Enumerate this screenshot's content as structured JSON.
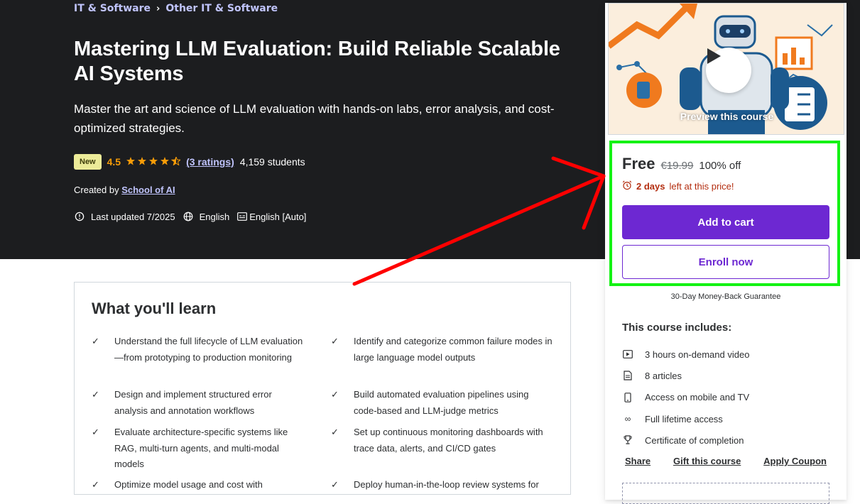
{
  "breadcrumb": {
    "items": [
      "IT & Software",
      "Other IT & Software"
    ]
  },
  "course": {
    "title": "Mastering LLM Evaluation: Build Reliable Scalable AI Systems",
    "subtitle": "Master the art and science of LLM evaluation with hands-on labs, error analysis, and cost-optimized strategies.",
    "badge": "New",
    "rating": "4.5",
    "rating_value": 4.5,
    "ratings_count": "(3 ratings)",
    "students": "4,159 students",
    "created_by_label": "Created by",
    "author": "School of AI",
    "last_updated": "Last updated 7/2025",
    "language": "English",
    "captions": "English [Auto]"
  },
  "learn": {
    "title": "What you'll learn",
    "items": [
      "Understand the full lifecycle of LLM evaluation—from prototyping to production monitoring",
      "Identify and categorize common failure modes in large language model outputs",
      "Design and implement structured error analysis and annotation workflows",
      "Build automated evaluation pipelines using code-based and LLM-judge metrics",
      "Evaluate architecture-specific systems like RAG, multi-turn agents, and multi-modal models",
      "Set up continuous monitoring dashboards with trace data, alerts, and CI/CD gates",
      "Optimize model usage and cost with",
      "Deploy human-in-the-loop review systems for"
    ]
  },
  "sidebar": {
    "preview_label": "Preview this course",
    "price": "Free",
    "original_price": "€19.99",
    "discount": "100% off",
    "timer_bold": "2 days",
    "timer_rest": "left at this price!",
    "add_to_cart": "Add to cart",
    "enroll_now": "Enroll now",
    "guarantee": "30-Day Money-Back Guarantee",
    "includes_title": "This course includes:",
    "includes": [
      {
        "icon": "video-icon",
        "label": "3 hours on-demand video"
      },
      {
        "icon": "article-icon",
        "label": "8 articles"
      },
      {
        "icon": "mobile-icon",
        "label": "Access on mobile and TV"
      },
      {
        "icon": "infinity-icon",
        "label": "Full lifetime access"
      },
      {
        "icon": "trophy-icon",
        "label": "Certificate of completion"
      }
    ],
    "links": [
      "Share",
      "Gift this course",
      "Apply Coupon"
    ]
  },
  "colors": {
    "hero_bg": "#1c1d1f",
    "brand_purple": "#6d28d2",
    "link_lavender": "#c0c4fc",
    "star_orange": "#f69c08",
    "timer_red": "#b32d0f",
    "highlight_green": "#14f214",
    "annotation_red": "#ff0000"
  }
}
